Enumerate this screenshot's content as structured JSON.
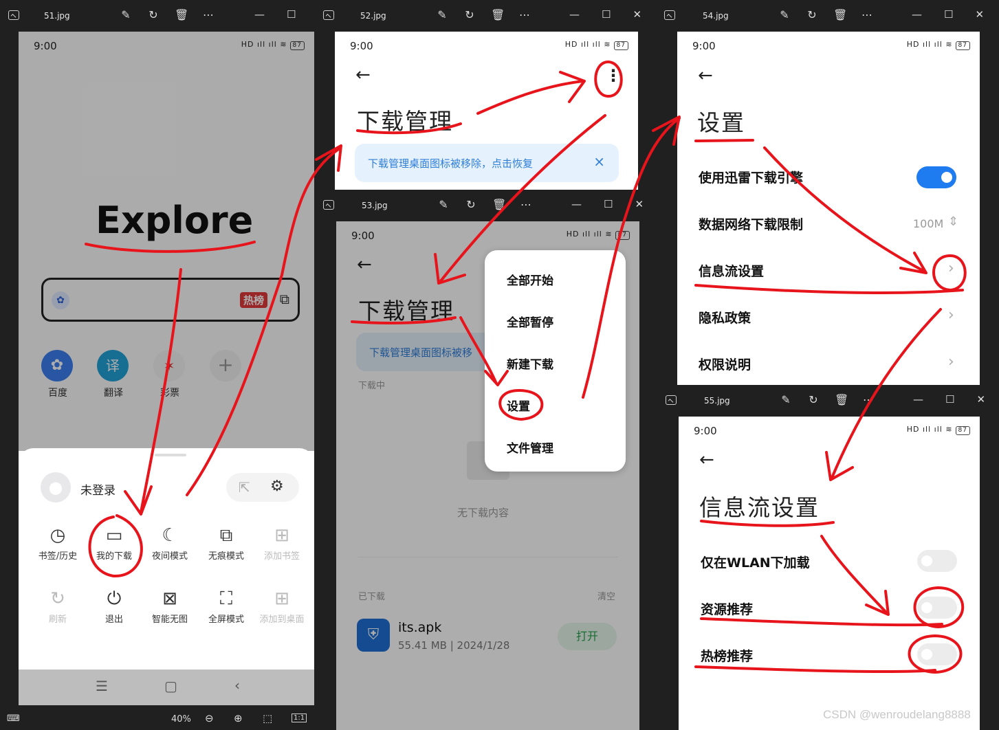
{
  "windows": [
    {
      "filename": "51.jpg"
    },
    {
      "filename": "52.jpg"
    },
    {
      "filename": "53.jpg"
    },
    {
      "filename": "54.jpg"
    },
    {
      "filename": "55.jpg"
    }
  ],
  "viewer_status": {
    "zoom": "40%",
    "ratio": "1:1"
  },
  "status_bar": {
    "time": "9:00",
    "battery": "87",
    "signal": "HD ıll ıll ≋"
  },
  "screen1": {
    "title": "Explore",
    "search_badge": "热榜",
    "shortcuts": [
      "百度",
      "翻译",
      "彩票"
    ],
    "user_label": "未登录",
    "grid_row1": [
      {
        "label": "书签/历史",
        "icon": "clock-icon",
        "glyph": "◷"
      },
      {
        "label": "我的下载",
        "icon": "folder-icon",
        "glyph": "▭"
      },
      {
        "label": "夜间模式",
        "icon": "moon-icon",
        "glyph": "☾"
      },
      {
        "label": "无痕模式",
        "icon": "incognito-icon",
        "glyph": "⧉"
      },
      {
        "label": "添加书签",
        "icon": "bookmark-add-icon",
        "glyph": "⊞"
      }
    ],
    "grid_row2": [
      {
        "label": "刷新",
        "icon": "refresh-icon",
        "glyph": "↻"
      },
      {
        "label": "退出",
        "icon": "power-icon",
        "glyph": "⏻"
      },
      {
        "label": "智能无图",
        "icon": "no-image-icon",
        "glyph": "⊠"
      },
      {
        "label": "全屏模式",
        "icon": "fullscreen-icon",
        "glyph": "⛶"
      },
      {
        "label": "添加到桌面",
        "icon": "add-desktop-icon",
        "glyph": "⊞"
      }
    ]
  },
  "screen2": {
    "title": "下载管理",
    "banner": "下载管理桌面图标被移除，点击恢复",
    "close": "×"
  },
  "screen3": {
    "title": "下载管理",
    "banner": "下载管理桌面图标被移",
    "section_downloading": "下载中",
    "empty_text": "无下载内容",
    "section_downloaded": "已下载",
    "clear_label": "清空",
    "file": {
      "name": "its.apk",
      "meta": "55.41 MB | 2024/1/28",
      "action": "打开"
    },
    "menu": [
      "全部开始",
      "全部暂停",
      "新建下载",
      "设置",
      "文件管理"
    ]
  },
  "screen4": {
    "title": "设置",
    "rows": [
      {
        "label": "使用迅雷下载引擎"
      },
      {
        "label": "数据网络下载限制",
        "value": "100M"
      },
      {
        "label": "信息流设置"
      },
      {
        "label": "隐私政策"
      },
      {
        "label": "权限说明"
      }
    ]
  },
  "screen5": {
    "title": "信息流设置",
    "rows": [
      {
        "label": "仅在WLAN下加载"
      },
      {
        "label": "资源推荐"
      },
      {
        "label": "热榜推荐"
      }
    ]
  },
  "watermark": "CSDN @wenroudelang8888",
  "colors": {
    "annotation": "#e8141c",
    "toggle_on": "#1f7bf0",
    "banner": "#e5f1fd",
    "banner_text": "#2f7ed8",
    "open_button": "#e6f6ea"
  }
}
